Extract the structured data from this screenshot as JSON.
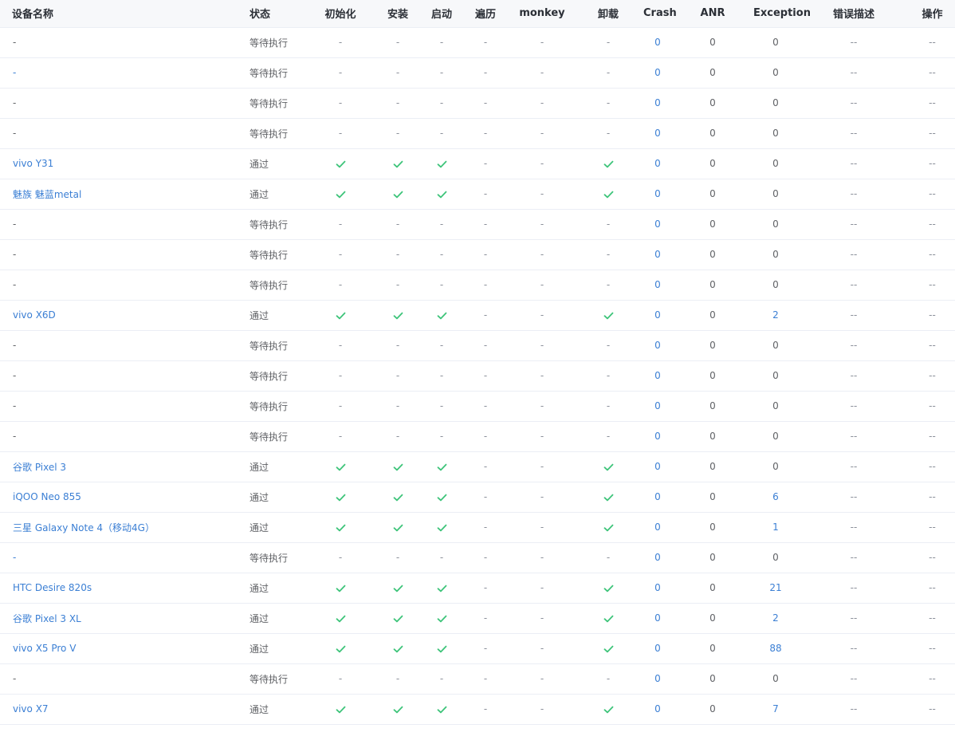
{
  "headers": {
    "name": "设备名称",
    "status": "状态",
    "init": "初始化",
    "install": "安装",
    "launch": "启动",
    "traverse": "遍历",
    "monkey": "monkey",
    "uninstall": "卸载",
    "crash": "Crash",
    "anr": "ANR",
    "exception": "Exception",
    "error_desc": "错误描述",
    "operation": "操作"
  },
  "colors": {
    "link": "#3b7fd4",
    "check": "#3ec47a",
    "text": "#606266",
    "header_bg": "#f7f8fa",
    "border": "#ebeef5"
  },
  "icons": {
    "pass": "check-icon"
  },
  "rows": [
    {
      "name": "-",
      "name_link": false,
      "status": "等待执行",
      "init": "-",
      "install": "-",
      "launch": "-",
      "traverse": "-",
      "monkey": "-",
      "uninstall": "-",
      "crash": "0",
      "anr": "0",
      "exception": "0",
      "exception_link": false,
      "error_desc": "--",
      "operation": "--"
    },
    {
      "name": "-",
      "name_link": true,
      "status": "等待执行",
      "init": "-",
      "install": "-",
      "launch": "-",
      "traverse": "-",
      "monkey": "-",
      "uninstall": "-",
      "crash": "0",
      "anr": "0",
      "exception": "0",
      "exception_link": false,
      "error_desc": "--",
      "operation": "--"
    },
    {
      "name": "-",
      "name_link": false,
      "status": "等待执行",
      "init": "-",
      "install": "-",
      "launch": "-",
      "traverse": "-",
      "monkey": "-",
      "uninstall": "-",
      "crash": "0",
      "anr": "0",
      "exception": "0",
      "exception_link": false,
      "error_desc": "--",
      "operation": "--"
    },
    {
      "name": "-",
      "name_link": false,
      "status": "等待执行",
      "init": "-",
      "install": "-",
      "launch": "-",
      "traverse": "-",
      "monkey": "-",
      "uninstall": "-",
      "crash": "0",
      "anr": "0",
      "exception": "0",
      "exception_link": false,
      "error_desc": "--",
      "operation": "--"
    },
    {
      "name": "vivo Y31",
      "name_link": true,
      "status": "通过",
      "init": "pass",
      "install": "pass",
      "launch": "pass",
      "traverse": "-",
      "monkey": "-",
      "uninstall": "pass",
      "crash": "0",
      "anr": "0",
      "exception": "0",
      "exception_link": false,
      "error_desc": "--",
      "operation": "--"
    },
    {
      "name": "魅族 魅蓝metal",
      "name_link": true,
      "status": "通过",
      "init": "pass",
      "install": "pass",
      "launch": "pass",
      "traverse": "-",
      "monkey": "-",
      "uninstall": "pass",
      "crash": "0",
      "anr": "0",
      "exception": "0",
      "exception_link": false,
      "error_desc": "--",
      "operation": "--"
    },
    {
      "name": "-",
      "name_link": false,
      "status": "等待执行",
      "init": "-",
      "install": "-",
      "launch": "-",
      "traverse": "-",
      "monkey": "-",
      "uninstall": "-",
      "crash": "0",
      "anr": "0",
      "exception": "0",
      "exception_link": false,
      "error_desc": "--",
      "operation": "--"
    },
    {
      "name": "-",
      "name_link": false,
      "status": "等待执行",
      "init": "-",
      "install": "-",
      "launch": "-",
      "traverse": "-",
      "monkey": "-",
      "uninstall": "-",
      "crash": "0",
      "anr": "0",
      "exception": "0",
      "exception_link": false,
      "error_desc": "--",
      "operation": "--"
    },
    {
      "name": "-",
      "name_link": false,
      "status": "等待执行",
      "init": "-",
      "install": "-",
      "launch": "-",
      "traverse": "-",
      "monkey": "-",
      "uninstall": "-",
      "crash": "0",
      "anr": "0",
      "exception": "0",
      "exception_link": false,
      "error_desc": "--",
      "operation": "--"
    },
    {
      "name": "vivo X6D",
      "name_link": true,
      "status": "通过",
      "init": "pass",
      "install": "pass",
      "launch": "pass",
      "traverse": "-",
      "monkey": "-",
      "uninstall": "pass",
      "crash": "0",
      "anr": "0",
      "exception": "2",
      "exception_link": true,
      "error_desc": "--",
      "operation": "--"
    },
    {
      "name": "-",
      "name_link": false,
      "status": "等待执行",
      "init": "-",
      "install": "-",
      "launch": "-",
      "traverse": "-",
      "monkey": "-",
      "uninstall": "-",
      "crash": "0",
      "anr": "0",
      "exception": "0",
      "exception_link": false,
      "error_desc": "--",
      "operation": "--"
    },
    {
      "name": "-",
      "name_link": false,
      "status": "等待执行",
      "init": "-",
      "install": "-",
      "launch": "-",
      "traverse": "-",
      "monkey": "-",
      "uninstall": "-",
      "crash": "0",
      "anr": "0",
      "exception": "0",
      "exception_link": false,
      "error_desc": "--",
      "operation": "--"
    },
    {
      "name": "-",
      "name_link": false,
      "status": "等待执行",
      "init": "-",
      "install": "-",
      "launch": "-",
      "traverse": "-",
      "monkey": "-",
      "uninstall": "-",
      "crash": "0",
      "anr": "0",
      "exception": "0",
      "exception_link": false,
      "error_desc": "--",
      "operation": "--"
    },
    {
      "name": "-",
      "name_link": false,
      "status": "等待执行",
      "init": "-",
      "install": "-",
      "launch": "-",
      "traverse": "-",
      "monkey": "-",
      "uninstall": "-",
      "crash": "0",
      "anr": "0",
      "exception": "0",
      "exception_link": false,
      "error_desc": "--",
      "operation": "--"
    },
    {
      "name": "谷歌 Pixel 3",
      "name_link": true,
      "status": "通过",
      "init": "pass",
      "install": "pass",
      "launch": "pass",
      "traverse": "-",
      "monkey": "-",
      "uninstall": "pass",
      "crash": "0",
      "anr": "0",
      "exception": "0",
      "exception_link": false,
      "error_desc": "--",
      "operation": "--"
    },
    {
      "name": "iQOO Neo 855",
      "name_link": true,
      "status": "通过",
      "init": "pass",
      "install": "pass",
      "launch": "pass",
      "traverse": "-",
      "monkey": "-",
      "uninstall": "pass",
      "crash": "0",
      "anr": "0",
      "exception": "6",
      "exception_link": true,
      "error_desc": "--",
      "operation": "--"
    },
    {
      "name": "三星 Galaxy Note 4（移动4G）",
      "name_link": true,
      "status": "通过",
      "init": "pass",
      "install": "pass",
      "launch": "pass",
      "traverse": "-",
      "monkey": "-",
      "uninstall": "pass",
      "crash": "0",
      "anr": "0",
      "exception": "1",
      "exception_link": true,
      "error_desc": "--",
      "operation": "--"
    },
    {
      "name": "-",
      "name_link": true,
      "status": "等待执行",
      "init": "-",
      "install": "-",
      "launch": "-",
      "traverse": "-",
      "monkey": "-",
      "uninstall": "-",
      "crash": "0",
      "anr": "0",
      "exception": "0",
      "exception_link": false,
      "error_desc": "--",
      "operation": "--"
    },
    {
      "name": "HTC Desire 820s",
      "name_link": true,
      "status": "通过",
      "init": "pass",
      "install": "pass",
      "launch": "pass",
      "traverse": "-",
      "monkey": "-",
      "uninstall": "pass",
      "crash": "0",
      "anr": "0",
      "exception": "21",
      "exception_link": true,
      "error_desc": "--",
      "operation": "--"
    },
    {
      "name": "谷歌 Pixel 3 XL",
      "name_link": true,
      "status": "通过",
      "init": "pass",
      "install": "pass",
      "launch": "pass",
      "traverse": "-",
      "monkey": "-",
      "uninstall": "pass",
      "crash": "0",
      "anr": "0",
      "exception": "2",
      "exception_link": true,
      "error_desc": "--",
      "operation": "--"
    },
    {
      "name": "vivo X5 Pro V",
      "name_link": true,
      "status": "通过",
      "init": "pass",
      "install": "pass",
      "launch": "pass",
      "traverse": "-",
      "monkey": "-",
      "uninstall": "pass",
      "crash": "0",
      "anr": "0",
      "exception": "88",
      "exception_link": true,
      "error_desc": "--",
      "operation": "--"
    },
    {
      "name": "-",
      "name_link": false,
      "status": "等待执行",
      "init": "-",
      "install": "-",
      "launch": "-",
      "traverse": "-",
      "monkey": "-",
      "uninstall": "-",
      "crash": "0",
      "anr": "0",
      "exception": "0",
      "exception_link": false,
      "error_desc": "--",
      "operation": "--"
    },
    {
      "name": "vivo X7",
      "name_link": true,
      "status": "通过",
      "init": "pass",
      "install": "pass",
      "launch": "pass",
      "traverse": "-",
      "monkey": "-",
      "uninstall": "pass",
      "crash": "0",
      "anr": "0",
      "exception": "7",
      "exception_link": true,
      "error_desc": "--",
      "operation": "--"
    }
  ]
}
